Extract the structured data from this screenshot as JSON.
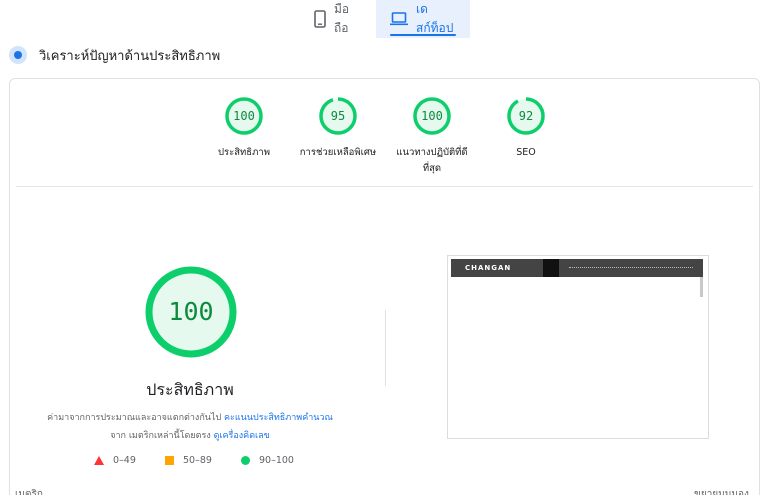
{
  "tabs": [
    {
      "label": "มือถือ",
      "icon": "phone-icon",
      "active": false
    },
    {
      "label": "เดสก์ท็อป",
      "icon": "laptop-icon",
      "active": true
    }
  ],
  "section": {
    "title": "วิเคราะห์ปัญหาด้านประสิทธิภาพ",
    "icon": "diagnose-icon"
  },
  "gauges": [
    {
      "score": "100",
      "label": "ประสิทธิภาพ",
      "fraction": 1.0
    },
    {
      "score": "95",
      "label": "การช่วยเหลือพิเศษ",
      "fraction": 0.95
    },
    {
      "score": "100",
      "label": "แนวทางปฏิบัติที่ดี ที่สุด",
      "fraction": 1.0
    },
    {
      "score": "92",
      "label": "SEO",
      "fraction": 0.92
    }
  ],
  "main_gauge": {
    "score": "100",
    "title": "ประสิทธิภาพ",
    "fraction": 1.0
  },
  "note": {
    "text1": "ค่ามาจากการประมาณและอาจแตกต่างกันไป ",
    "link1": "คะแนนประสิทธิภาพคำนวณ",
    "text2": "จาก เมตริกเหล่านี้โดยตรง ",
    "link2": "ดูเครื่องคิดเลข"
  },
  "legend": [
    {
      "range": "0–49",
      "shape": "triangle",
      "color": "#ff3333"
    },
    {
      "range": "50–89",
      "shape": "square",
      "color": "#ffa400"
    },
    {
      "range": "90–100",
      "shape": "circle",
      "color": "#0cce6b"
    }
  ],
  "preview": {
    "logo": "CHANGAN"
  },
  "footer": {
    "metrics_label": "เมตริก",
    "expand_label": "ขยายมุมมอง"
  },
  "colors": {
    "pass": "#0cce6b",
    "pass_text": "#0c8a3e",
    "pass_fill": "#e6f9ee",
    "accent": "#1a73e8"
  }
}
